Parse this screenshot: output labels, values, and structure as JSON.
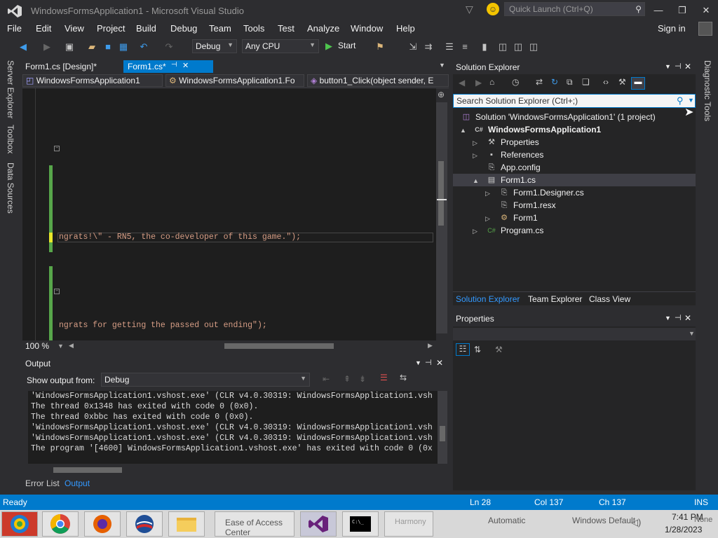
{
  "window": {
    "title": "WindowsFormsApplication1 - Microsoft Visual Studio",
    "quick_launch_placeholder": "Quick Launch (Ctrl+Q)",
    "buttons": {
      "minimize": "—",
      "restore": "❐",
      "close": "✕"
    }
  },
  "menu": {
    "items": [
      "File",
      "Edit",
      "View",
      "Project",
      "Build",
      "Debug",
      "Team",
      "Tools",
      "Test",
      "Analyze",
      "Window",
      "Help"
    ],
    "signin": "Sign in"
  },
  "toolbar": {
    "config": "Debug",
    "platform": "Any CPU",
    "start": "Start"
  },
  "left_tabs": [
    "Server Explorer",
    "Toolbox",
    "Data Sources"
  ],
  "right_tabs": [
    "Diagnostic Tools"
  ],
  "doc_tabs": [
    {
      "label": "Form1.cs [Design]*",
      "active": false
    },
    {
      "label": "Form1.cs*",
      "active": true
    }
  ],
  "nav_bar": {
    "project": "WindowsFormsApplication1",
    "class": "WindowsFormsApplication1.Fo",
    "member": "button1_Click(object sender, E"
  },
  "editor": {
    "line1": "ngrats!\\\" - RN5, the co-developer of this game.\");",
    "line2": "ngrats for getting the passed out ending\");",
    "zoom": "100 %"
  },
  "output": {
    "title": "Output",
    "show_from_label": "Show output from:",
    "show_from_value": "Debug",
    "lines": [
      "'WindowsFormsApplication1.vshost.exe' (CLR v4.0.30319: WindowsFormsApplication1.vsh",
      "The thread 0x1348 has exited with code 0 (0x0).",
      "The thread 0xbbc has exited with code 0 (0x0).",
      "'WindowsFormsApplication1.vshost.exe' (CLR v4.0.30319: WindowsFormsApplication1.vsh",
      "'WindowsFormsApplication1.vshost.exe' (CLR v4.0.30319: WindowsFormsApplication1.vsh",
      "The program '[4600] WindowsFormsApplication1.vshost.exe' has exited with code 0 (0x"
    ]
  },
  "bottom_tabs": [
    "Error List",
    "Output"
  ],
  "solution_explorer": {
    "title": "Solution Explorer",
    "search_placeholder": "Search Solution Explorer (Ctrl+;)",
    "tree": [
      {
        "label": "Solution 'WindowsFormsApplication1' (1 project)",
        "depth": 0,
        "arrow": "",
        "icon": "solution-icon",
        "bold": false
      },
      {
        "label": "WindowsFormsApplication1",
        "depth": 1,
        "arrow": "▲",
        "icon": "csharp-project-icon",
        "bold": true
      },
      {
        "label": "Properties",
        "depth": 2,
        "arrow": "▷",
        "icon": "wrench-icon",
        "bold": false
      },
      {
        "label": "References",
        "depth": 2,
        "arrow": "▷",
        "icon": "references-icon",
        "bold": false
      },
      {
        "label": "App.config",
        "depth": 2,
        "arrow": "",
        "icon": "config-file-icon",
        "bold": false
      },
      {
        "label": "Form1.cs",
        "depth": 2,
        "arrow": "▲",
        "icon": "form-icon",
        "bold": false
      },
      {
        "label": "Form1.Designer.cs",
        "depth": 3,
        "arrow": "▷",
        "icon": "code-file-icon",
        "bold": false
      },
      {
        "label": "Form1.resx",
        "depth": 3,
        "arrow": "",
        "icon": "resx-file-icon",
        "bold": false
      },
      {
        "label": "Form1",
        "depth": 3,
        "arrow": "▷",
        "icon": "class-icon",
        "bold": false
      },
      {
        "label": "Program.cs",
        "depth": 2,
        "arrow": "▷",
        "icon": "csharp-file-icon",
        "bold": false
      }
    ],
    "tabs": [
      "Solution Explorer",
      "Team Explorer",
      "Class View"
    ]
  },
  "properties": {
    "title": "Properties"
  },
  "status": {
    "state": "Ready",
    "ln": "Ln 28",
    "col": "Col 137",
    "ch": "Ch 137",
    "mode": "INS"
  },
  "taskbar": {
    "time": "7:41 PM",
    "date": "1/28/2023",
    "ghost_text_1": "Ease of Access Center",
    "ghost_text_2": "Automatic",
    "ghost_text_3": "Windows Default",
    "ghost_text_4": "Harmony",
    "ghost_text_5": "None"
  },
  "colors": {
    "accent": "#007acc",
    "bg": "#2d2d30",
    "editor": "#1e1e1e",
    "string": "#d69d85"
  }
}
